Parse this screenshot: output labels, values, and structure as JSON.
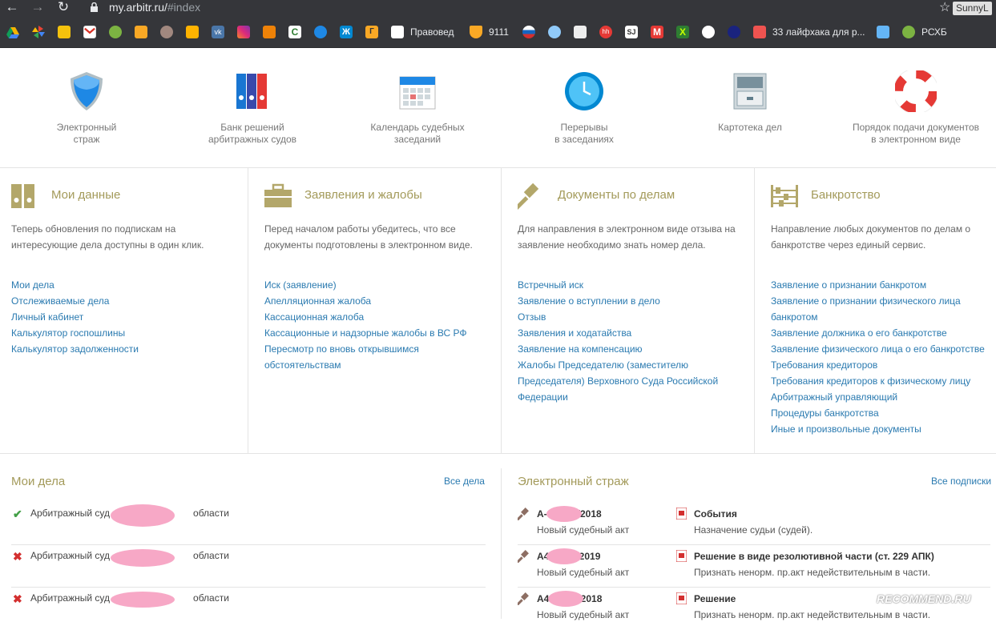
{
  "browser": {
    "url_host": "my.arbitr.ru/",
    "url_path": "#index",
    "profile": "SunnyL",
    "bookmarks": {
      "pravoved": "Правовед",
      "n9111": "9111",
      "layfhaki": "33 лайфхака для р...",
      "rshb": "РСХБ"
    }
  },
  "tools": [
    {
      "label": "Электронный\nстраж"
    },
    {
      "label": "Банк решений\nарбитражных судов"
    },
    {
      "label": "Календарь судебных\nзаседаний"
    },
    {
      "label": "Перерывы\nв заседаниях"
    },
    {
      "label": "Картотека дел"
    },
    {
      "label": "Порядок подачи документов\nв электронном виде"
    }
  ],
  "panels": {
    "my_data": {
      "title": "Мои данные",
      "desc": "Теперь обновления по подпискам на интересующие дела доступны в один клик.",
      "links": [
        "Мои дела",
        "Отслеживаемые дела",
        "Личный кабинет",
        "Калькулятор госпошлины",
        "Калькулятор задолженности"
      ]
    },
    "claims": {
      "title": "Заявления и жалобы",
      "desc": "Перед началом работы убедитесь, что все документы подготовлены в электронном виде.",
      "links": [
        "Иск (заявление)",
        "Апелляционная жалоба",
        "Кассационная жалоба",
        "Кассационные и надзорные жалобы в ВС РФ",
        "Пересмотр по вновь открывшимся обстоятельствам"
      ]
    },
    "docs": {
      "title": "Документы по делам",
      "desc": "Для направления в электронном виде отзыва на заявление необходимо знать номер дела.",
      "links": [
        "Встречный иск",
        "Заявление о вступлении в дело",
        "Отзыв",
        "Заявления и ходатайства",
        "Заявление на компенсацию",
        "Жалобы Председателю (заместителю Председателя) Верховного Суда Российской Федерации"
      ]
    },
    "bankruptcy": {
      "title": "Банкротство",
      "desc": "Направление любых документов по делам о банкротстве через единый сервис.",
      "links": [
        "Заявление о признании банкротом",
        "Заявление о признании физического лица банкротом",
        "Заявление должника о его банкротстве",
        "Заявление физического лица о его банкротстве",
        "Требования кредиторов",
        "Требования кредиторов к физическому лицу",
        "Арбитражный управляющий",
        "Процедуры банкротства",
        "Иные и произвольные документы"
      ]
    }
  },
  "my_cases": {
    "title": "Мои дела",
    "all_link": "Все дела",
    "items": [
      {
        "status": "ok",
        "court_prefix": "Арбитражный суд",
        "court_suffix": "области"
      },
      {
        "status": "error",
        "court_prefix": "Арбитражный суд",
        "court_suffix": "области"
      },
      {
        "status": "error",
        "court_prefix": "Арбитражный суд",
        "court_suffix": "области"
      }
    ]
  },
  "guard": {
    "title": "Электронный страж",
    "all_link": "Все подписки",
    "items": [
      {
        "case_prefix": "А-",
        "case_suffix": "/2018",
        "case_sub": "Новый судебный акт",
        "event": "События",
        "event_sub": "Назначение судьи (судей)."
      },
      {
        "case_prefix": "А4",
        "case_suffix": "/2019",
        "case_sub": "Новый судебный акт",
        "event": "Решение в виде резолютивной части (ст. 229 АПК)",
        "event_sub": "Признать ненорм. пр.акт недействительным в части."
      },
      {
        "case_prefix": "А4",
        "case_suffix": "/2018",
        "case_sub": "Новый судебный акт",
        "event": "Решение",
        "event_sub": "Признать ненорм. пр.акт недействительным в части."
      }
    ]
  },
  "watermark": "RECOMMEND.RU"
}
